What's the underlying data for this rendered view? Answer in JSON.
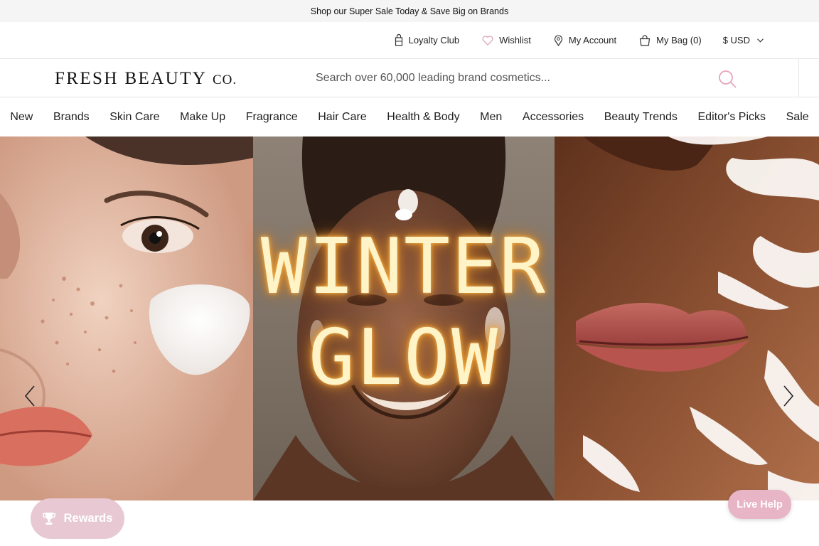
{
  "promo": {
    "text": "Shop our Super Sale Today & Save Big on Brands"
  },
  "utility": {
    "loyalty": "Loyalty Club",
    "wishlist": "Wishlist",
    "account": "My Account",
    "bag": "My Bag (0)",
    "currency": "$ USD"
  },
  "logo": {
    "main": "FRESH BEAUTY ",
    "suffix": "CO."
  },
  "search": {
    "placeholder": "Search over 60,000 leading brand cosmetics..."
  },
  "nav": {
    "items": [
      "New",
      "Brands",
      "Skin Care",
      "Make Up",
      "Fragrance",
      "Hair Care",
      "Health & Body",
      "Men",
      "Accessories",
      "Beauty Trends",
      "Editor's Picks",
      "Sale"
    ]
  },
  "hero": {
    "line1": "WINTER",
    "line2": "GLOW"
  },
  "widgets": {
    "rewards": "Rewards",
    "live_help": "Live Help"
  },
  "colors": {
    "rewards_bg": "#e8c9d3",
    "live_help_bg": "#e8b5c6",
    "headline_glow": "#ffb84a"
  },
  "icons": [
    "store-icon",
    "heart-icon",
    "user-pin-icon",
    "bag-icon",
    "chevron-down-icon",
    "search-icon",
    "chevron-left-icon",
    "chevron-right-icon",
    "trophy-icon"
  ]
}
